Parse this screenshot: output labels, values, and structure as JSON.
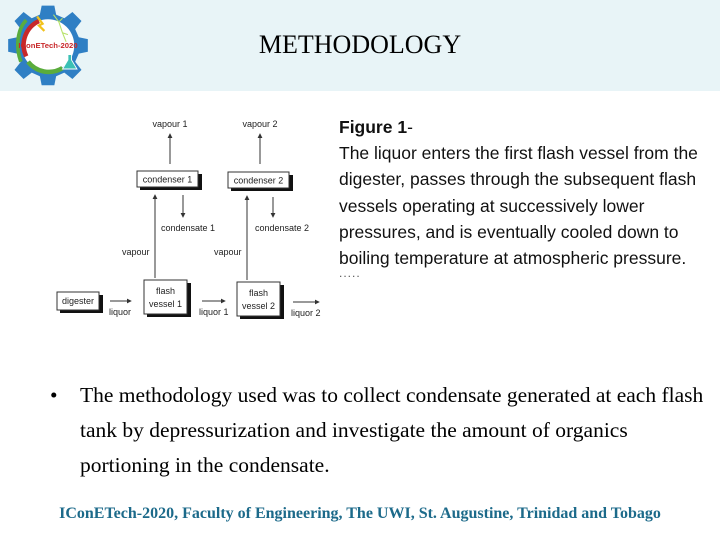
{
  "header": {
    "title": "METHODOLOGY",
    "logo_text": "IConETech-2020",
    "logo_icon": "gear-logo-icon"
  },
  "diagram": {
    "nodes": {
      "digester": "digester",
      "flash_vessel_1_line1": "flash",
      "flash_vessel_1_line2": "vessel 1",
      "flash_vessel_2_line1": "flash",
      "flash_vessel_2_line2": "vessel 2",
      "condenser_1": "condenser 1",
      "condenser_2": "condenser 2"
    },
    "labels": {
      "vapour_1": "vapour 1",
      "vapour_2": "vapour 2",
      "condensate_1": "condensate 1",
      "condensate_2": "condensate 2",
      "vapour_a": "vapour",
      "vapour_b": "vapour",
      "liquor": "liquor",
      "liquor_1": "liquor 1",
      "liquor_2": "liquor 2"
    }
  },
  "caption": {
    "figure_label": "Figure 1",
    "figure_suffix": "-",
    "text": "The liquor enters the first flash vessel from the digester, passes through the subsequent flash vessels operating at successively lower pressures, and is eventually cooled down to boiling temperature at atmospheric pressure.",
    "trailing_dots": "....."
  },
  "body": {
    "bullet_symbol": "•",
    "bullet_text": "The methodology used was to collect condensate generated at each flash tank by depressurization and investigate the amount of organics portioning in the condensate."
  },
  "footer": {
    "text": "IConETech-2020, Faculty of Engineering, The UWI, St. Augustine, Trinidad and Tobago",
    "color": "#1c6a8a"
  },
  "colors": {
    "header_bg": "#e8f4f7",
    "gear_blue": "#2f7fc4",
    "ring_red": "#c8282a",
    "ring_green": "#5aac3c"
  }
}
